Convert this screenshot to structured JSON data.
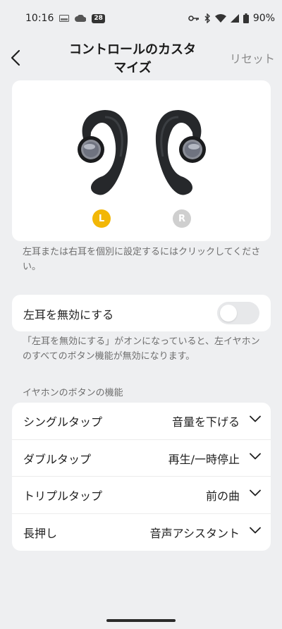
{
  "status_bar": {
    "time": "10:16",
    "calendar_badge": "28",
    "battery": "90%",
    "icons_left": [
      "notification-image-icon",
      "cloud-icon",
      "calendar-icon"
    ],
    "icons_right": [
      "key-icon",
      "bluetooth-icon",
      "wifi-icon",
      "signal-icon",
      "battery-icon"
    ]
  },
  "header": {
    "title": "コントロールのカスタマイズ",
    "reset_label": "リセット"
  },
  "earbuds": {
    "left_badge": "L",
    "right_badge": "R",
    "left_badge_color": "#f2b706",
    "right_badge_color": "#cfcfcf",
    "hint": "左耳または右耳を個別に設定するにはクリックしてください。"
  },
  "disable_left": {
    "label": "左耳を無効にする",
    "enabled": false,
    "description": "「左耳を無効にする」がオンになっていると、左イヤホンのすべてのボタン機能が無効になります。"
  },
  "button_functions": {
    "section_title": "イヤホンのボタンの機能",
    "rows": [
      {
        "name": "シングルタップ",
        "value": "音量を下げる"
      },
      {
        "name": "ダブルタップ",
        "value": "再生/一時停止"
      },
      {
        "name": "トリプルタップ",
        "value": "前の曲"
      },
      {
        "name": "長押し",
        "value": "音声アシスタント"
      }
    ]
  }
}
